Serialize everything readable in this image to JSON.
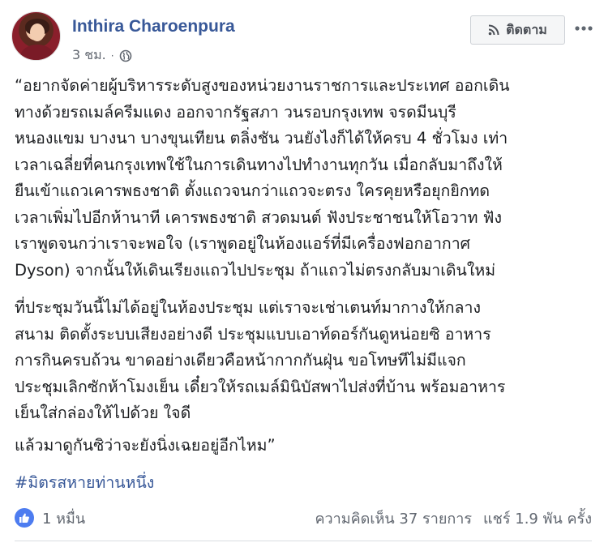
{
  "post": {
    "author": "Inthira Charoenpura",
    "time": "3 ชม.",
    "dot": "·",
    "follow_label": "ติดตาม",
    "para1": "“อยากจัดค่ายผู้บริหารระดับสูงของหน่วยงานราชการและประเทศ ออกเดิน\nทางด้วยรถเมล์ครีมแดง ออกจากรัฐสภา วนรอบกรุงเทพ จรดมีนบุรี\nหนองแขม บางนา บางขุนเทียน ตลิ่งชัน วนยังไงก็ได้ให้ครบ 4 ชั่วโมง เท่า\nเวลาเฉลี่ยที่คนกรุงเทพใช้ในการเดินทางไปทำงานทุกวัน เมื่อกลับมาถึงให้\nยืนเข้าแถวเคารพธงชาติ ตั้งแถวจนกว่าแถวจะตรง ใครคุยหรือยุกยิกทด\nเวลาเพิ่มไปอีกห้านาที เคารพธงชาติ สวดมนต์ ฟังประชาชนให้โอวาท ฟัง\nเราพูดจนกว่าเราจะพอใจ (เราพูดอยู่ในห้องแอร์ที่มีเครื่องฟอกอากาศ\nDyson) จากนั้นให้เดินเรียงแถวไปประชุม ถ้าแถวไม่ตรงกลับมาเดินใหม่",
    "para2": "ที่ประชุมวันนี้ไม่ได้อยู่ในห้องประชุม แต่เราจะเช่าเตนท์มากางให้กลาง\nสนาม ติดตั้งระบบเสียงอย่างดี ประชุมแบบเอาท์ดอร์กันดูหน่อยซิ อาหาร\nการกินครบถ้วน ขาดอย่างเดียวคือหน้ากากกันฝุ่น ขอโทษทีไม่มีแจก\nประชุมเลิกซักห้าโมงเย็น เดี๋ยวให้รถเมล์มินิบัสพาไปส่งที่บ้าน พร้อมอาหาร\nเย็นใส่กล่องให้ไปด้วย ใจดี",
    "para3": "แล้วมาดูกันซิว่าจะยังนิ่งเฉยอยู่อีกไหม”",
    "hashtag": "#มิตรสหายท่านหนึ่ง",
    "likes": "1 หมื่น",
    "comments": "ความคิดเห็น 37 รายการ",
    "shares": "แชร์ 1.9 พัน ครั้ง"
  },
  "icons": {
    "privacy": "globe-icon",
    "follow": "rss-icon",
    "more": "ellipsis-icon",
    "reaction": "thumbs-up-icon"
  },
  "colors": {
    "link": "#385898",
    "like": "#4d7cf0",
    "meta": "#616770"
  }
}
